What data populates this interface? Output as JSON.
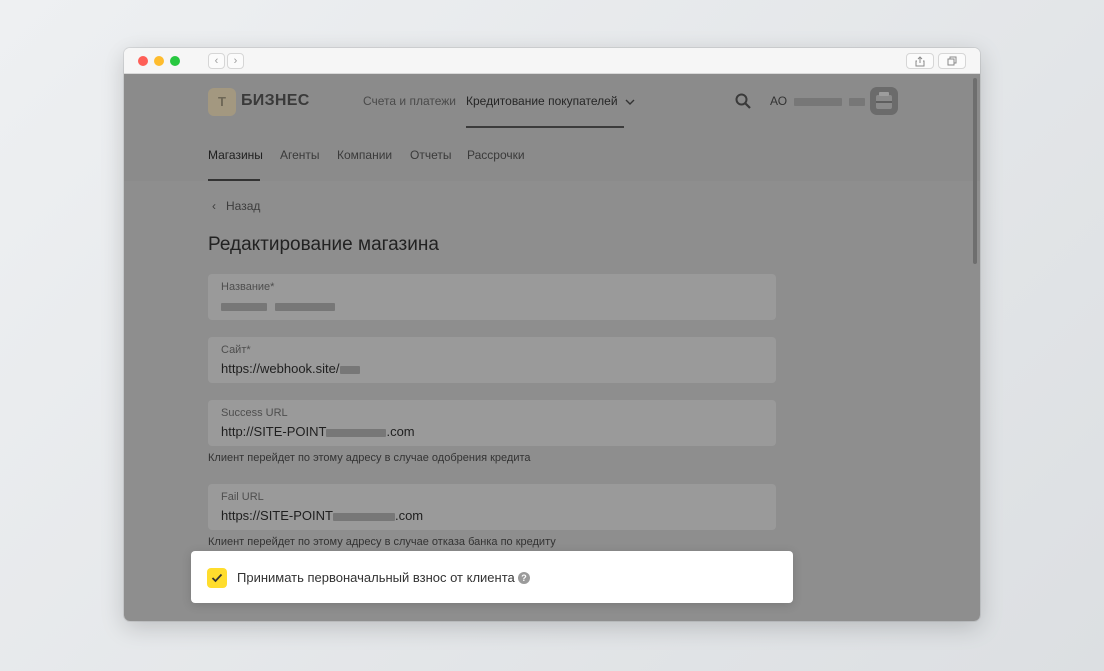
{
  "browser": {
    "back_icon": "‹",
    "forward_icon": "›",
    "share_icon": "share-icon",
    "tabs_icon": "tabs-icon"
  },
  "header": {
    "logo_letter": "Т",
    "logo_text": "БИЗНЕС",
    "nav": [
      {
        "label": "Счета и платежи"
      },
      {
        "label": "Кредитование покупателей"
      }
    ],
    "company_prefix": "АО"
  },
  "subnav": {
    "items": [
      {
        "label": "Магазины"
      },
      {
        "label": "Агенты"
      },
      {
        "label": "Компании"
      },
      {
        "label": "Отчеты"
      },
      {
        "label": "Рассрочки"
      }
    ]
  },
  "back": {
    "label": "Назад"
  },
  "page": {
    "title": "Редактирование магазина"
  },
  "form": {
    "name": {
      "label": "Название*"
    },
    "site": {
      "label": "Сайт*",
      "value": "https://webhook.site/"
    },
    "success_url": {
      "label": "Success URL",
      "value_prefix": "http://SITE-POINT",
      "value_suffix": ".com",
      "hint": "Клиент перейдет по этому адресу в случае одобрения кредита"
    },
    "fail_url": {
      "label": "Fail URL",
      "value_prefix": "https://SITE-POINT",
      "value_suffix": ".com",
      "hint": "Клиент перейдет по этому адресу в случае отказа банка по кредиту"
    }
  },
  "popover": {
    "checkbox_label": "Принимать первоначальный взнос от клиента",
    "checked": true,
    "help": "?"
  },
  "colors": {
    "accent": "#ffdd2d",
    "overlay": "#8e8e8e"
  }
}
